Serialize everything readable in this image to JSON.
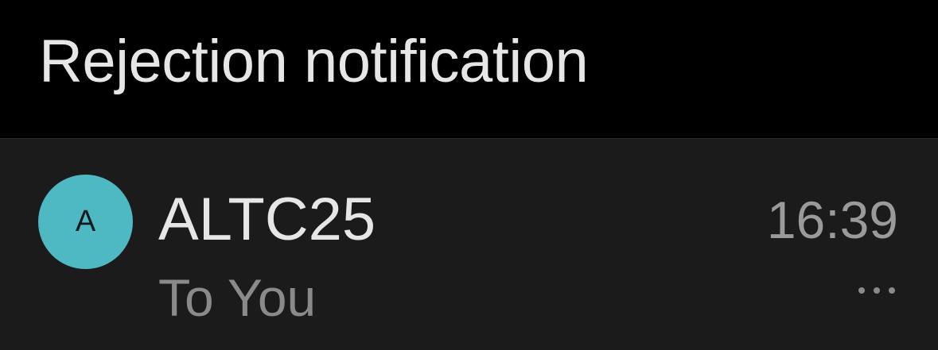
{
  "header": {
    "title": "Rejection notification"
  },
  "message": {
    "avatar_letter": "A",
    "avatar_color": "#4fb9c3",
    "sender": "ALTC25",
    "recipient": "To You",
    "time": "16:39",
    "more_icon": "more-dots-icon"
  }
}
